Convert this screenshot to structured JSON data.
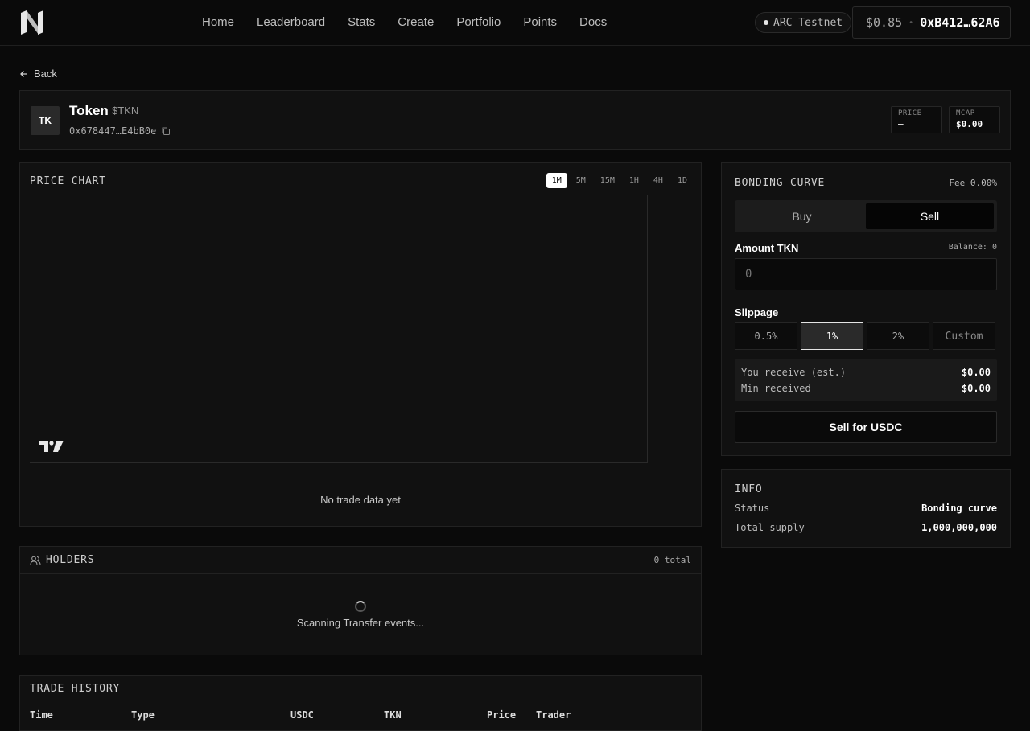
{
  "header": {
    "nav": [
      "Home",
      "Leaderboard",
      "Stats",
      "Create",
      "Portfolio",
      "Points",
      "Docs"
    ],
    "network": "ARC Testnet",
    "wallet_balance": "$0.85",
    "wallet_separator": "•",
    "wallet_address": "0xB412…62A6"
  },
  "back_label": "Back",
  "token": {
    "badge": "TK",
    "name": "Token",
    "symbol": "$TKN",
    "address": "0x678447…E4bB0e",
    "price_label": "PRICE",
    "price_value": "—",
    "mcap_label": "MCAP",
    "mcap_value": "$0.00"
  },
  "chart": {
    "title": "PRICE CHART",
    "timeframes": [
      "1M",
      "5M",
      "15M",
      "1H",
      "4H",
      "1D"
    ],
    "active_timeframe": "1M",
    "empty_text": "No trade data yet"
  },
  "holders": {
    "title": "HOLDERS",
    "total": "0 total",
    "loading_text": "Scanning Transfer events..."
  },
  "history": {
    "title": "TRADE HISTORY",
    "columns": [
      "Time",
      "Type",
      "USDC",
      "TKN",
      "Price",
      "Trader"
    ]
  },
  "bonding": {
    "title": "BONDING CURVE",
    "fee": "Fee 0.00%",
    "buy_label": "Buy",
    "sell_label": "Sell",
    "amount_label": "Amount TKN",
    "balance_label": "Balance: 0",
    "amount_placeholder": "0",
    "slippage_label": "Slippage",
    "slippage_options": [
      "0.5%",
      "1%",
      "2%"
    ],
    "slippage_custom_placeholder": "Custom",
    "receive_label": "You receive (est.)",
    "receive_value": "$0.00",
    "min_label": "Min received",
    "min_value": "$0.00",
    "submit_label": "Sell for USDC"
  },
  "info": {
    "title": "INFO",
    "status_label": "Status",
    "status_value": "Bonding curve",
    "supply_label": "Total supply",
    "supply_value": "1,000,000,000"
  }
}
